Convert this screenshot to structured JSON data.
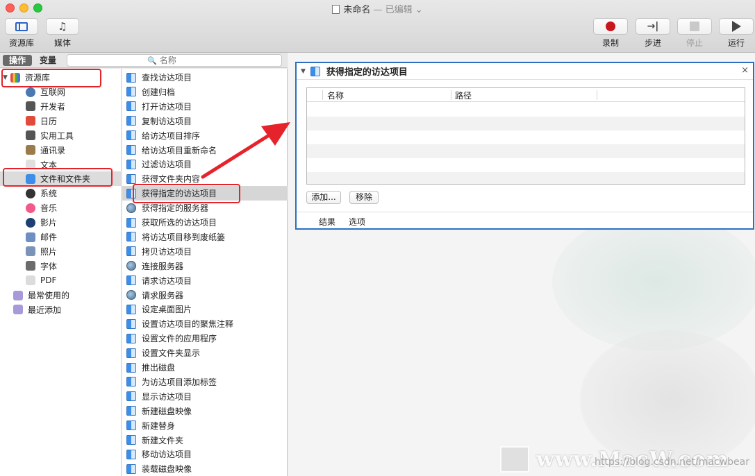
{
  "window": {
    "title": "未命名",
    "edited_suffix": "— 已编辑",
    "chevron": "⌄"
  },
  "toolbar": {
    "library_label": "资源库",
    "media_label": "媒体",
    "record_label": "录制",
    "step_label": "步进",
    "stop_label": "停止",
    "run_label": "运行"
  },
  "left_header": {
    "actions_tab": "操作",
    "variables_tab": "变量",
    "search_placeholder": "名称"
  },
  "library": {
    "root": "资源库",
    "items": [
      {
        "label": "互联网",
        "icon": "globe-icon",
        "color": "#4a78b0"
      },
      {
        "label": "开发者",
        "icon": "tools-icon",
        "color": "#555555"
      },
      {
        "label": "日历",
        "icon": "calendar-icon",
        "color": "#e04b3a"
      },
      {
        "label": "实用工具",
        "icon": "tools-icon",
        "color": "#555555"
      },
      {
        "label": "通讯录",
        "icon": "contacts-icon",
        "color": "#9b7a4c"
      },
      {
        "label": "文本",
        "icon": "text-icon",
        "color": "#e0e0e0"
      },
      {
        "label": "文件和文件夹",
        "icon": "finder-icon",
        "color": "#3c8ee8"
      },
      {
        "label": "系统",
        "icon": "system-icon",
        "color": "#333333"
      },
      {
        "label": "音乐",
        "icon": "music-icon",
        "color": "#f25a8a"
      },
      {
        "label": "影片",
        "icon": "movie-icon",
        "color": "#1e3f73"
      },
      {
        "label": "邮件",
        "icon": "mail-icon",
        "color": "#6d8fc3"
      },
      {
        "label": "照片",
        "icon": "photos-icon",
        "color": "#7a93b8"
      },
      {
        "label": "字体",
        "icon": "font-icon",
        "color": "#6b6b6b"
      },
      {
        "label": "PDF",
        "icon": "pdf-icon",
        "color": "#dcdcdc"
      }
    ],
    "smart_groups": [
      {
        "label": "最常使用的",
        "icon": "folder-gear-icon",
        "color": "#a89ad8"
      },
      {
        "label": "最近添加",
        "icon": "folder-gear-icon",
        "color": "#a89ad8"
      }
    ]
  },
  "actions": [
    {
      "label": "查找访达项目",
      "icon": "finder-icon"
    },
    {
      "label": "创建归档",
      "icon": "finder-icon"
    },
    {
      "label": "打开访达项目",
      "icon": "finder-icon"
    },
    {
      "label": "复制访达项目",
      "icon": "finder-icon"
    },
    {
      "label": "给访达项目排序",
      "icon": "finder-icon"
    },
    {
      "label": "给访达项目重新命名",
      "icon": "finder-icon"
    },
    {
      "label": "过滤访达项目",
      "icon": "finder-icon"
    },
    {
      "label": "获得文件夹内容",
      "icon": "finder-icon"
    },
    {
      "label": "获得指定的访达项目",
      "icon": "finder-icon"
    },
    {
      "label": "获得指定的服务器",
      "icon": "globe-icon"
    },
    {
      "label": "获取所选的访达项目",
      "icon": "finder-icon"
    },
    {
      "label": "将访达项目移到废纸篓",
      "icon": "finder-icon"
    },
    {
      "label": "拷贝访达项目",
      "icon": "finder-icon"
    },
    {
      "label": "连接服务器",
      "icon": "globe-icon"
    },
    {
      "label": "请求访达项目",
      "icon": "finder-icon"
    },
    {
      "label": "请求服务器",
      "icon": "globe-icon"
    },
    {
      "label": "设定桌面图片",
      "icon": "finder-icon"
    },
    {
      "label": "设置访达项目的聚焦注释",
      "icon": "finder-icon"
    },
    {
      "label": "设置文件的应用程序",
      "icon": "finder-icon"
    },
    {
      "label": "设置文件夹显示",
      "icon": "finder-icon"
    },
    {
      "label": "推出磁盘",
      "icon": "finder-icon"
    },
    {
      "label": "为访达项目添加标签",
      "icon": "finder-icon"
    },
    {
      "label": "显示访达项目",
      "icon": "finder-icon"
    },
    {
      "label": "新建磁盘映像",
      "icon": "finder-icon"
    },
    {
      "label": "新建替身",
      "icon": "finder-icon"
    },
    {
      "label": "新建文件夹",
      "icon": "finder-icon"
    },
    {
      "label": "移动访达项目",
      "icon": "finder-icon"
    },
    {
      "label": "装载磁盘映像",
      "icon": "finder-icon"
    }
  ],
  "action_card": {
    "title": "获得指定的访达项目",
    "close_glyph": "×",
    "columns": [
      "名称",
      "路径"
    ],
    "add_button": "添加...",
    "remove_button": "移除",
    "footer_tabs": [
      "结果",
      "选项"
    ]
  },
  "watermark": {
    "brand": "www.MacW.com",
    "url": "https://blog.csdn.net/macwbear"
  },
  "accent_color": "#2c6fc0",
  "annotation_color": "#e6232a"
}
